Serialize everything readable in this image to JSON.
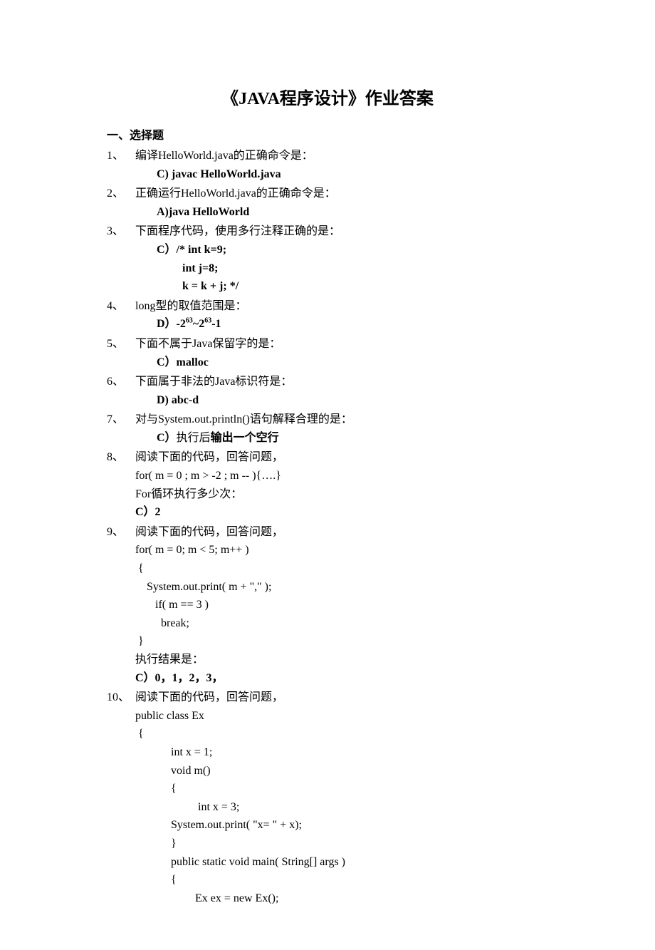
{
  "title": "《JAVA程序设计》作业答案",
  "section_header": "一、选择题",
  "questions": [
    {
      "num": "1、",
      "text": "编译HelloWorld.java的正确命令是：",
      "answer_lines": [
        "C) javac HelloWorld.java"
      ]
    },
    {
      "num": "2、",
      "text": "正确运行HelloWorld.java的正确命令是：",
      "answer_lines": [
        "A)java HelloWorld"
      ]
    },
    {
      "num": "3、",
      "text": "下面程序代码，使用多行注释正确的是：",
      "answer_lines": [
        "C）/* int k=9;"
      ],
      "extra_lines": [
        "int j=8;",
        "k = k + j; */"
      ]
    },
    {
      "num": "4、",
      "text": "long型的取值范围是：",
      "answer_html": "D）-2<sup>63</sup>~2<sup>63</sup>-1"
    },
    {
      "num": "5、",
      "text": "下面不属于Java保留字的是：",
      "answer_lines": [
        "C）malloc"
      ]
    },
    {
      "num": "6、",
      "text": "下面属于非法的Java标识符是：",
      "answer_lines": [
        "D) abc-d"
      ]
    },
    {
      "num": "7、",
      "text": "对与System.out.println()语句解释合理的是：",
      "answer_mixed": {
        "prefix": "C）",
        "normal": "执行后",
        "bold": "输出一个空行"
      }
    },
    {
      "num": "8、",
      "text": "阅读下面的代码，回答问题，",
      "code": [
        "for( m = 0 ; m > -2 ; m -- ){….}",
        "For循环执行多少次："
      ],
      "answer_simple": "C）2"
    },
    {
      "num": "9、",
      "text": "阅读下面的代码，回答问题，",
      "code9": [
        "for( m = 0; m < 5; m++ )",
        " {",
        "    System.out.print( m + \",\" );",
        "       if( m == 3 )",
        "         break;",
        " }",
        "执行结果是："
      ],
      "answer_simple": "C）0，1，2，3，"
    },
    {
      "num": "10、",
      "text": "  阅读下面的代码，回答问题，",
      "code10": [
        {
          "indent": 1,
          "text": "public class Ex"
        },
        {
          "indent": 1,
          "text": " {"
        },
        {
          "indent": 3,
          "text": "int x = 1;"
        },
        {
          "indent": 3,
          "text": "void m()"
        },
        {
          "indent": 3,
          "text": "{"
        },
        {
          "indent": 4,
          "text": "    int x = 3;"
        },
        {
          "indent": 3,
          "text": "System.out.print( \"x= \" + x);"
        },
        {
          "indent": 3,
          "text": "}"
        },
        {
          "indent": 3,
          "text": "public static void main( String[] args )"
        },
        {
          "indent": 3,
          "text": "{"
        },
        {
          "indent": 4,
          "text": "   Ex ex = new Ex();"
        }
      ]
    }
  ]
}
